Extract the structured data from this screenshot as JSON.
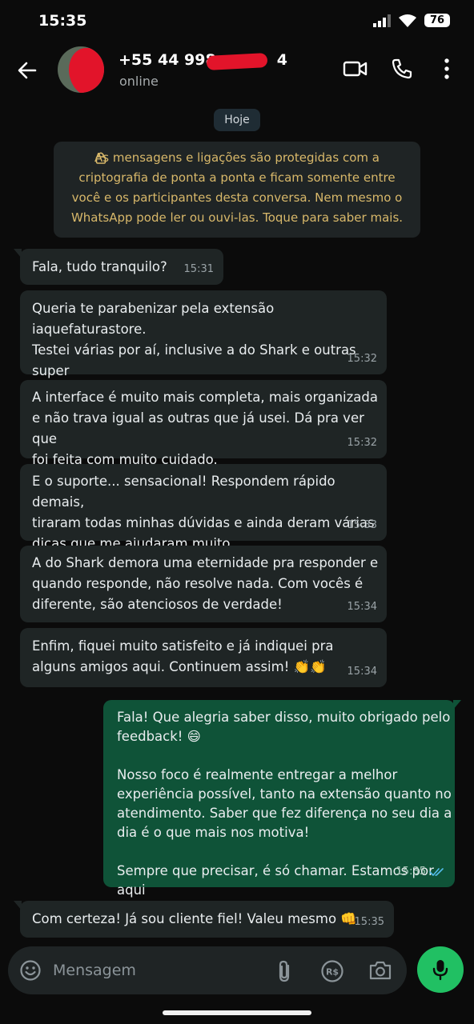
{
  "status_bar": {
    "time": "15:35",
    "battery": "76"
  },
  "header": {
    "contact_name": "+55 44 998",
    "contact_name_suffix": "4",
    "contact_status": "online"
  },
  "chat": {
    "date_chip": "Hoje",
    "encryption_notice": "As mensagens e ligações são protegidas com a\ncriptografia de ponta a ponta e ficam somente entre\nvocê e os participantes desta conversa. Nem mesmo o\nWhatsApp pode ler ou ouvi-las. Toque para saber mais.",
    "messages": [
      {
        "direction": "in",
        "text": "Fala, tudo tranquilo?",
        "time": "15:31"
      },
      {
        "direction": "in",
        "text": "Queria te parabenizar pela extensão iaquefaturastore.\nTestei várias por aí, inclusive a do Shark e outras super\nfamosas, mas a de vocês é disparada a melhor!",
        "time": "15:32"
      },
      {
        "direction": "in",
        "text": "A interface é muito mais completa, mais organizada\ne não trava igual as outras que já usei. Dá pra ver que\nfoi feita com muito cuidado.",
        "time": "15:32"
      },
      {
        "direction": "in",
        "text": "E o suporte... sensacional! Respondem rápido demais,\ntiraram todas minhas dúvidas e ainda deram várias\ndicas que me ajudaram muito.",
        "time": "15:33"
      },
      {
        "direction": "in",
        "text": "A do Shark demora uma eternidade pra responder e\nquando responde, não resolve nada. Com vocês é\ndiferente, são atenciosos de verdade!",
        "time": "15:34"
      },
      {
        "direction": "in",
        "text": "Enfim, fiquei muito satisfeito e já indiquei pra\nalguns amigos aqui. Continuem assim! 👏👏",
        "time": "15:34"
      },
      {
        "direction": "out",
        "text": "Fala! Que alegria saber disso, muito obrigado pelo\nfeedback! 😄\n\nNosso foco é realmente entregar a melhor\nexperiência possível, tanto na extensão quanto no\natendimento. Saber que fez diferença no seu dia a\ndia é o que mais nos motiva!\n\nSempre que precisar, é só chamar. Estamos por aqui\npra te ajudar no que for preciso! 🚀",
        "time": "15:35"
      },
      {
        "direction": "in",
        "text": "Com certeza! Já sou cliente fiel! Valeu mesmo 👊",
        "time": "15:35"
      }
    ]
  },
  "composer": {
    "placeholder": "Mensagem"
  },
  "colors": {
    "incoming_bubble": "#1f2525",
    "outgoing_bubble": "#0f5338",
    "accent_green": "#21c063",
    "notice_text": "#d8b86a"
  },
  "icons": [
    "back-arrow-icon",
    "video-call-icon",
    "phone-icon",
    "more-icon",
    "lock-icon",
    "emoji-icon",
    "attach-icon",
    "payment-icon",
    "camera-icon",
    "mic-icon",
    "double-check-icon"
  ]
}
